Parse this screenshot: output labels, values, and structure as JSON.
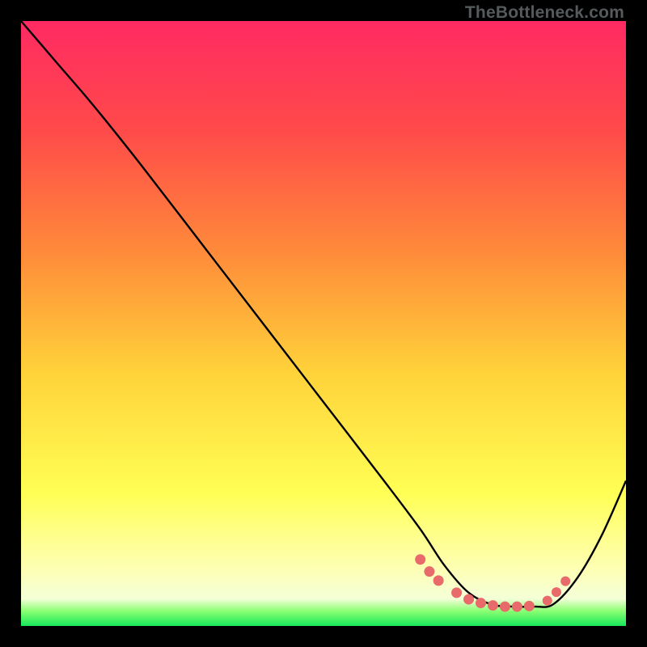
{
  "watermark": "TheBottleneck.com",
  "colors": {
    "frame": "#000000",
    "gradient_stops": [
      {
        "offset": 0.0,
        "color": "#ff2a62"
      },
      {
        "offset": 0.18,
        "color": "#ff4a4a"
      },
      {
        "offset": 0.38,
        "color": "#ff8a3a"
      },
      {
        "offset": 0.58,
        "color": "#ffd23a"
      },
      {
        "offset": 0.78,
        "color": "#ffff55"
      },
      {
        "offset": 0.9,
        "color": "#feffb0"
      },
      {
        "offset": 0.955,
        "color": "#f4ffd8"
      },
      {
        "offset": 0.975,
        "color": "#8cff74"
      },
      {
        "offset": 1.0,
        "color": "#17e85a"
      }
    ],
    "curve": "#000000",
    "dot": "#e86a6a"
  },
  "chart_data": {
    "type": "line",
    "title": "",
    "xlabel": "",
    "ylabel": "",
    "xlim": [
      0,
      100
    ],
    "ylim": [
      0,
      100
    ],
    "note": "Axes are implied (no ticks rendered). x≈0..100 left→right, y≈0..100 bottom→top. Curve is a bottleneck-style V with a flat-bottom trough.",
    "series": [
      {
        "name": "bottleneck-curve",
        "x": [
          0,
          6,
          12,
          20,
          30,
          40,
          50,
          60,
          66,
          70,
          74,
          78,
          82,
          85,
          88,
          92,
          96,
          100
        ],
        "y": [
          100,
          93,
          86,
          76,
          63,
          50,
          37,
          24,
          16,
          10,
          5.5,
          3.5,
          3.2,
          3.2,
          3.6,
          8,
          15,
          24
        ]
      }
    ],
    "trough_dots": {
      "name": "trough-markers",
      "x_left_cluster": [
        66,
        67.5,
        69,
        72,
        74,
        76,
        78,
        80,
        82,
        84
      ],
      "y_left_cluster": [
        11,
        9,
        7.5,
        5.5,
        4.4,
        3.8,
        3.4,
        3.2,
        3.2,
        3.3
      ],
      "x_right_cluster": [
        87,
        88.5,
        90
      ],
      "y_right_cluster": [
        4.2,
        5.6,
        7.4
      ]
    }
  }
}
